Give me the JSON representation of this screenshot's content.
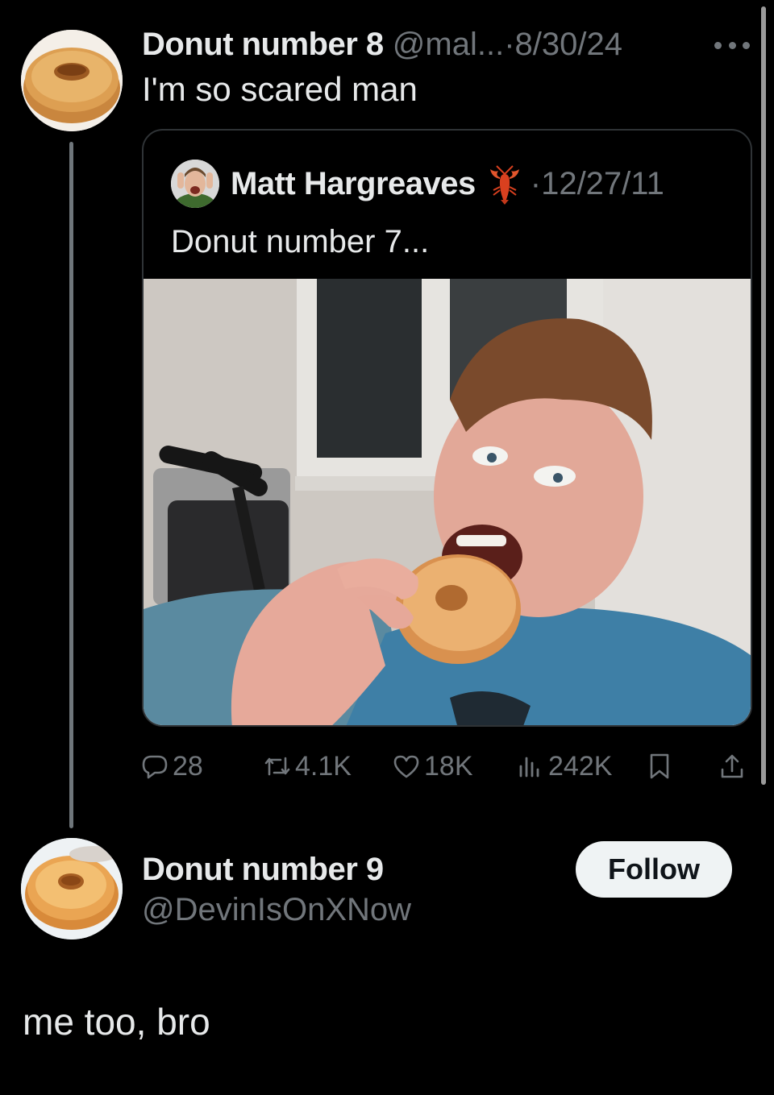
{
  "post1": {
    "author_name": "Donut number 8",
    "handle": "@mal...",
    "separator": "·",
    "date": "8/30/24",
    "text": "I'm so scared man"
  },
  "quote": {
    "author_name": "Matt Hargreaves",
    "separator": "·",
    "date": "12/27/11",
    "text": "Donut number 7..."
  },
  "actions": {
    "replies": "28",
    "reposts": "4.1K",
    "likes": "18K",
    "views": "242K"
  },
  "post2": {
    "author_name": "Donut number 9",
    "handle": "@DevinIsOnXNow",
    "follow_label": "Follow",
    "text": "me too, bro"
  },
  "colors": {
    "background": "#000000",
    "text": "#e7e9ea",
    "muted": "#71767b",
    "border": "#2f3336",
    "follow_bg": "#eff3f4"
  },
  "icons": [
    "more-icon",
    "reply-icon",
    "retweet-icon",
    "like-icon",
    "views-icon",
    "bookmark-icon",
    "share-icon",
    "lobster-emoji"
  ]
}
